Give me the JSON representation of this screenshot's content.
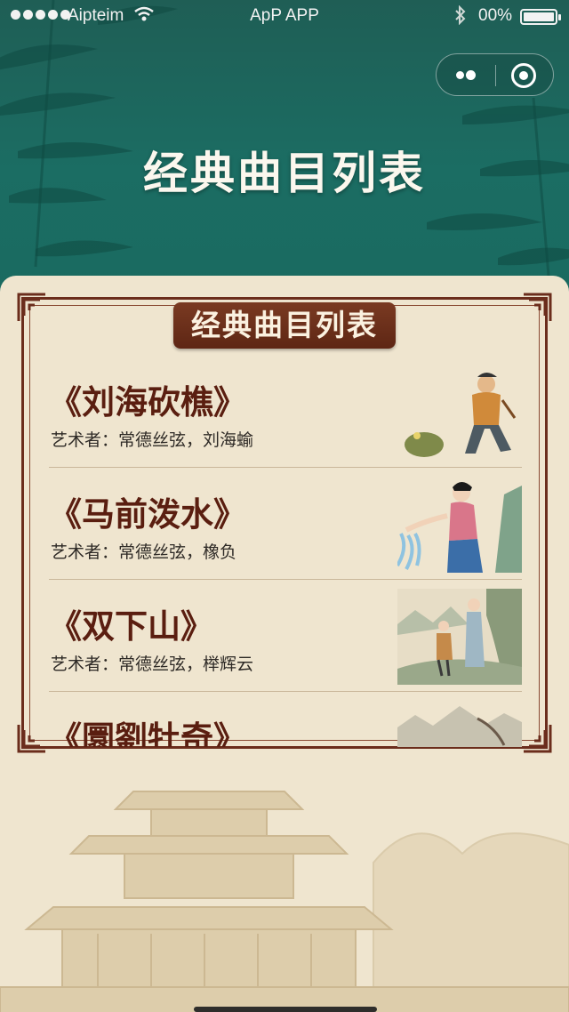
{
  "status_bar": {
    "carrier": "Aipteim",
    "time": "ApP APP",
    "battery_percent": "00%"
  },
  "capsule": {
    "more_icon": "more-dots-icon",
    "close_icon": "target-close-icon"
  },
  "header": {
    "title": "经典曲目列表"
  },
  "panel": {
    "banner_title": "经典曲目列表"
  },
  "pieces": [
    {
      "title": "《刘海砍樵》",
      "artists": "艺术者：常德丝弦，刘海蝓",
      "image": "woodcutter-and-toad"
    },
    {
      "title": "《马前泼水》",
      "artists": "艺术者：常德丝弦，橡负",
      "image": "woman-pouring-water"
    },
    {
      "title": "《双下山》",
      "artists": "艺术者：常德丝弦，榉辉云",
      "image": "two-figures-mountain"
    },
    {
      "title": "《圜劉牡奇》",
      "artists": "",
      "image": "mountain-landscape"
    }
  ],
  "colors": {
    "header_green": "#1b6d63",
    "paper": "#efe5cf",
    "frame_brown": "#6b2d1c",
    "title_red_brown": "#5a1e10"
  }
}
